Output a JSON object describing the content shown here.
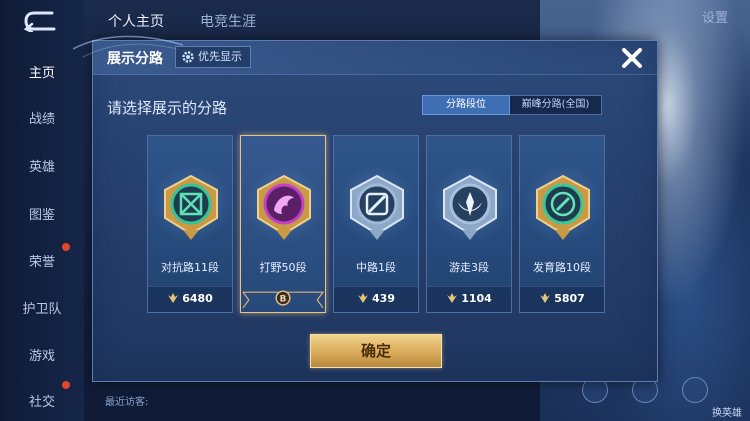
{
  "background": {
    "tabs": [
      "个人主页",
      "电竞生涯"
    ],
    "sidebar": [
      {
        "label": "主页",
        "active": true
      },
      {
        "label": "战绩"
      },
      {
        "label": "英雄"
      },
      {
        "label": "图鉴"
      },
      {
        "label": "荣誉"
      },
      {
        "label": "护卫队"
      },
      {
        "label": "游戏"
      },
      {
        "label": "社交"
      }
    ],
    "settings": "设置",
    "visitors": "最近访客:",
    "change_hero": "换英雄"
  },
  "modal": {
    "title": "展示分路",
    "priority_button": "优先显示",
    "subtitle": "请选择展示的分路",
    "segments": [
      "分路段位",
      "巅峰分路(全国)"
    ],
    "active_segment": 0,
    "cards": [
      {
        "rank": "对抗路11段",
        "points": "6480",
        "badge_color": "#37c39a",
        "icon": "clash-lane-icon",
        "selected": false
      },
      {
        "rank": "打野50段",
        "points": "",
        "badge_color": "#c23fc8",
        "icon": "jungle-dragon-icon",
        "selected": true,
        "tag": "B"
      },
      {
        "rank": "中路1段",
        "points": "439",
        "badge_color": "#9fb8d8",
        "icon": "mid-lane-icon",
        "selected": false
      },
      {
        "rank": "游走3段",
        "points": "1104",
        "badge_color": "#a8c0de",
        "icon": "roam-icon",
        "selected": false
      },
      {
        "rank": "发育路10段",
        "points": "5807",
        "badge_color": "#3cc79b",
        "icon": "farm-lane-icon",
        "selected": false
      }
    ],
    "confirm": "确定"
  }
}
